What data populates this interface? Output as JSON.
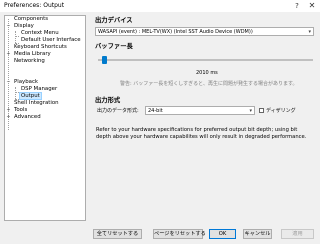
{
  "window": {
    "title": "Preferences: Output",
    "help_glyph": "?",
    "close_glyph": "✕"
  },
  "tree": {
    "items": [
      {
        "label": "Components"
      },
      {
        "label": "Display",
        "toggle": "−"
      },
      {
        "label": "Context Menu"
      },
      {
        "label": "Default User Interface"
      },
      {
        "label": "Keyboard Shortcuts"
      },
      {
        "label": "Media Library",
        "toggle": "+"
      },
      {
        "label": "Networking"
      },
      {
        "label": "Playback",
        "toggle": "−"
      },
      {
        "label": "DSP Manager"
      },
      {
        "label": "Output",
        "selected": true
      },
      {
        "label": "Shell Integration"
      },
      {
        "label": "Tools",
        "toggle": "+"
      },
      {
        "label": "Advanced",
        "toggle": "+"
      }
    ]
  },
  "output": {
    "device_heading": "出力デバイス",
    "device_value": "WASAPI (event) : MEL-TV(WX) (Intel SST Audio Device (WDM))",
    "buffer_heading": "バッファー長",
    "buffer_value_text": "2010 ms",
    "buffer_level": 0.02,
    "buffer_warning": "警告: バッファー長を短くしすぎると、再生に問題が発生する場合があります。",
    "format_heading": "出力形式",
    "format_label": "出力のデータ形式:",
    "format_value": "24-bit",
    "dither_label": "ディザリング",
    "description": "Refer to your hardware specifications for preferred output bit depth; using bit depth above your hardware capabilites will only result in degraded performance."
  },
  "buttons": {
    "reset_all": "全てリセットする",
    "reset_page": "ページをリセットする",
    "ok": "OK",
    "cancel": "キャンセル",
    "apply": "適用"
  },
  "icons": {
    "caret": "▾"
  },
  "colors": {
    "accent": "#007acc",
    "selection": "#cce8ff"
  }
}
